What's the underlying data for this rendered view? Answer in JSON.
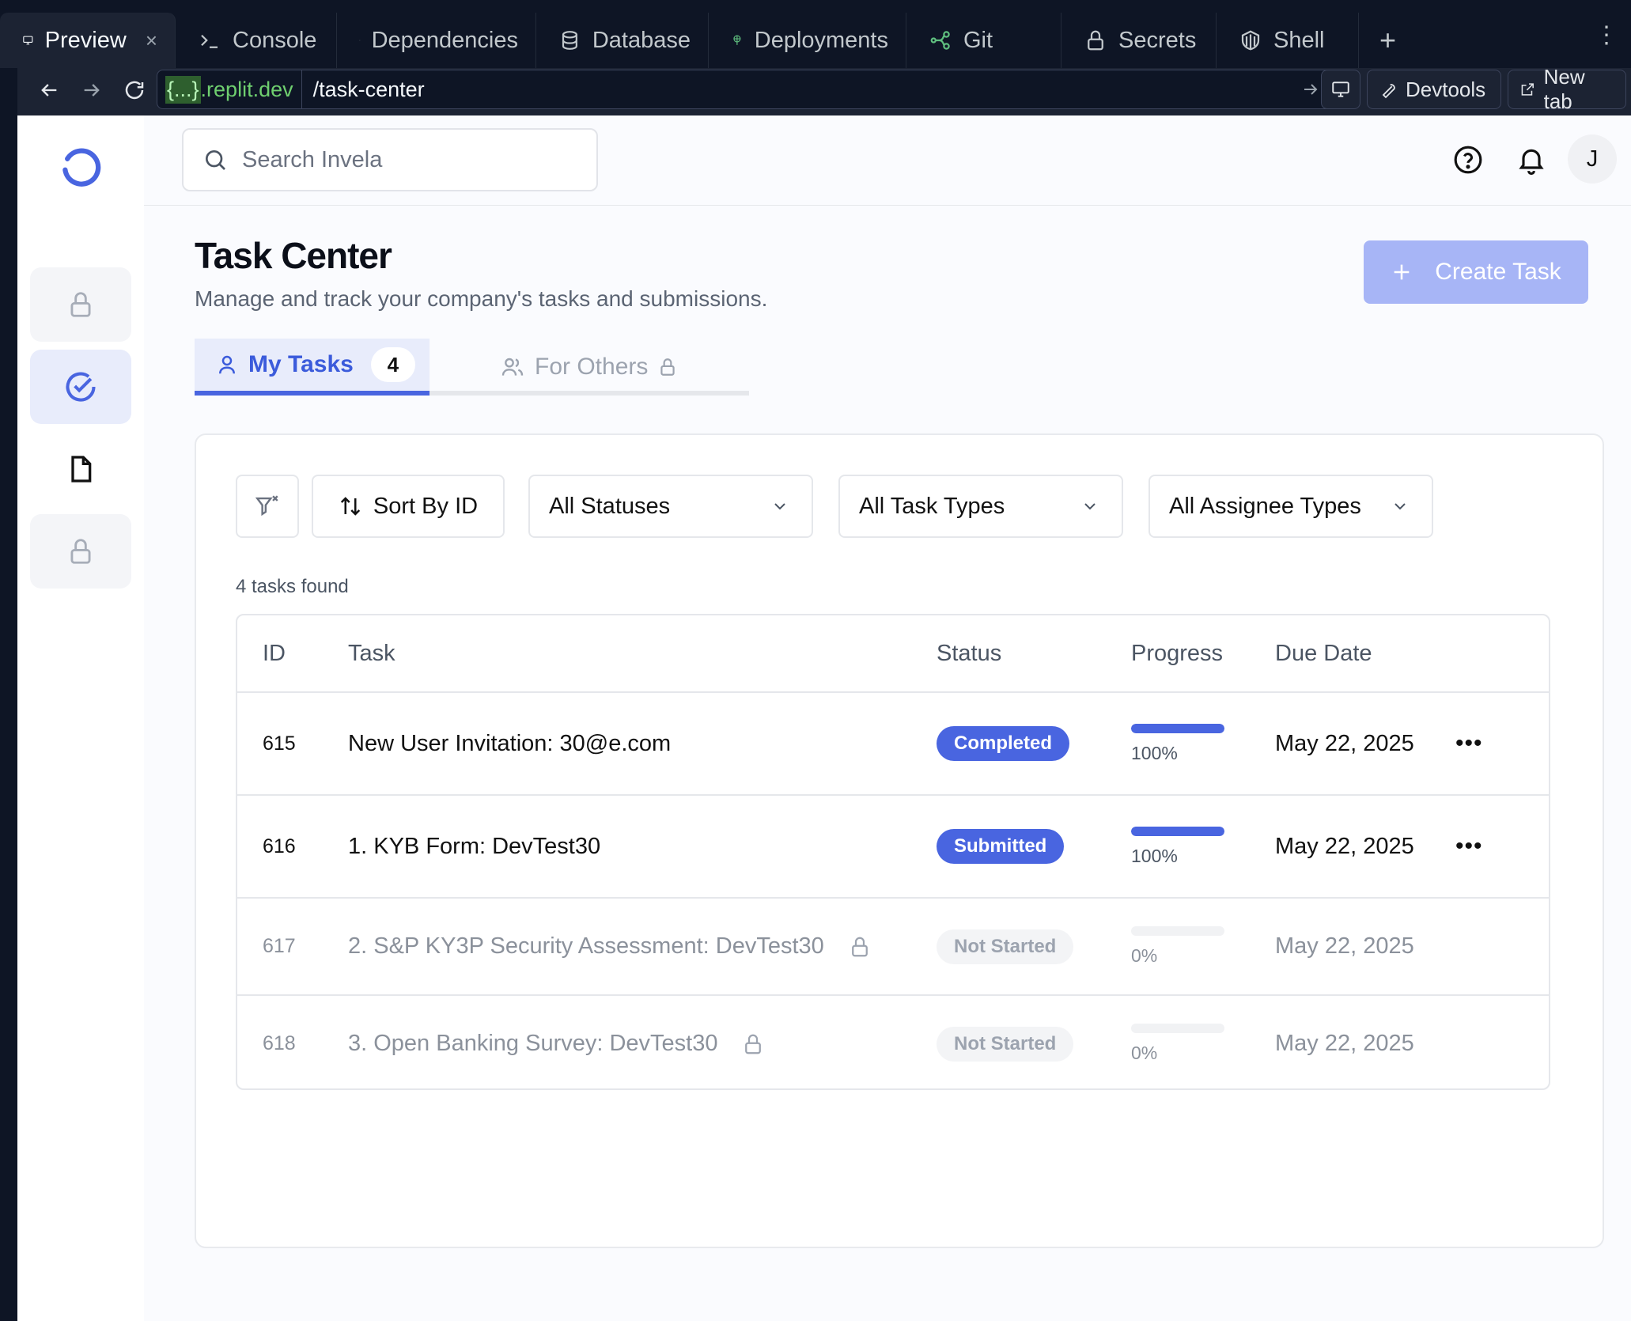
{
  "ide_tabs": [
    {
      "label": "Preview",
      "icon": "monitor-icon"
    },
    {
      "label": "Console",
      "icon": "terminal-icon"
    },
    {
      "label": "Dependencies",
      "icon": "package-icon"
    },
    {
      "label": "Database",
      "icon": "database-icon"
    },
    {
      "label": "Deployments",
      "icon": "deploy-icon"
    },
    {
      "label": "Git",
      "icon": "git-icon"
    },
    {
      "label": "Secrets",
      "icon": "lock-icon"
    },
    {
      "label": "Shell",
      "icon": "shell-icon"
    }
  ],
  "ide_tab_close": "×",
  "ide_tab_add": "+",
  "ide_menu": "⋮",
  "address": {
    "host_highlight": "{...}",
    "host_suffix": ".replit.dev",
    "path": "/task-center",
    "devtools_label": "Devtools",
    "newtab_label": "New tab"
  },
  "search": {
    "placeholder": "Search Invela"
  },
  "user": {
    "avatar_initial": "J"
  },
  "page": {
    "title": "Task Center",
    "subtitle": "Manage and track your company's tasks and submissions.",
    "create_label": "Create Task"
  },
  "tabs": {
    "my_label": "My Tasks",
    "my_count": "4",
    "others_label": "For Others"
  },
  "filters": {
    "sort_label": "Sort By ID",
    "status_value": "All Statuses",
    "type_value": "All Task Types",
    "assignee_value": "All Assignee Types"
  },
  "results_text": "4 tasks found",
  "table": {
    "headers": {
      "id": "ID",
      "task": "Task",
      "status": "Status",
      "progress": "Progress",
      "due": "Due Date"
    },
    "rows": [
      {
        "id": "615",
        "task": "New User Invitation: 30@e.com",
        "status": "Completed",
        "progress_label": "100%",
        "progress": 1.0,
        "due": "May 22, 2025",
        "locked": false
      },
      {
        "id": "616",
        "task": "1. KYB Form: DevTest30",
        "status": "Submitted",
        "progress_label": "100%",
        "progress": 1.0,
        "due": "May 22, 2025",
        "locked": false
      },
      {
        "id": "617",
        "task": "2. S&P KY3P Security Assessment: DevTest30",
        "status": "Not Started",
        "progress_label": "0%",
        "progress": 0,
        "due": "May 22, 2025",
        "locked": true
      },
      {
        "id": "618",
        "task": "3. Open Banking Survey: DevTest30",
        "status": "Not Started",
        "progress_label": "0%",
        "progress": 0,
        "due": "May 22, 2025",
        "locked": true
      }
    ],
    "more_glyph": "•••"
  },
  "colors": {
    "accent": "#4965e0",
    "accent_light": "#a7b5f6",
    "ide_bg": "#0e1525"
  }
}
